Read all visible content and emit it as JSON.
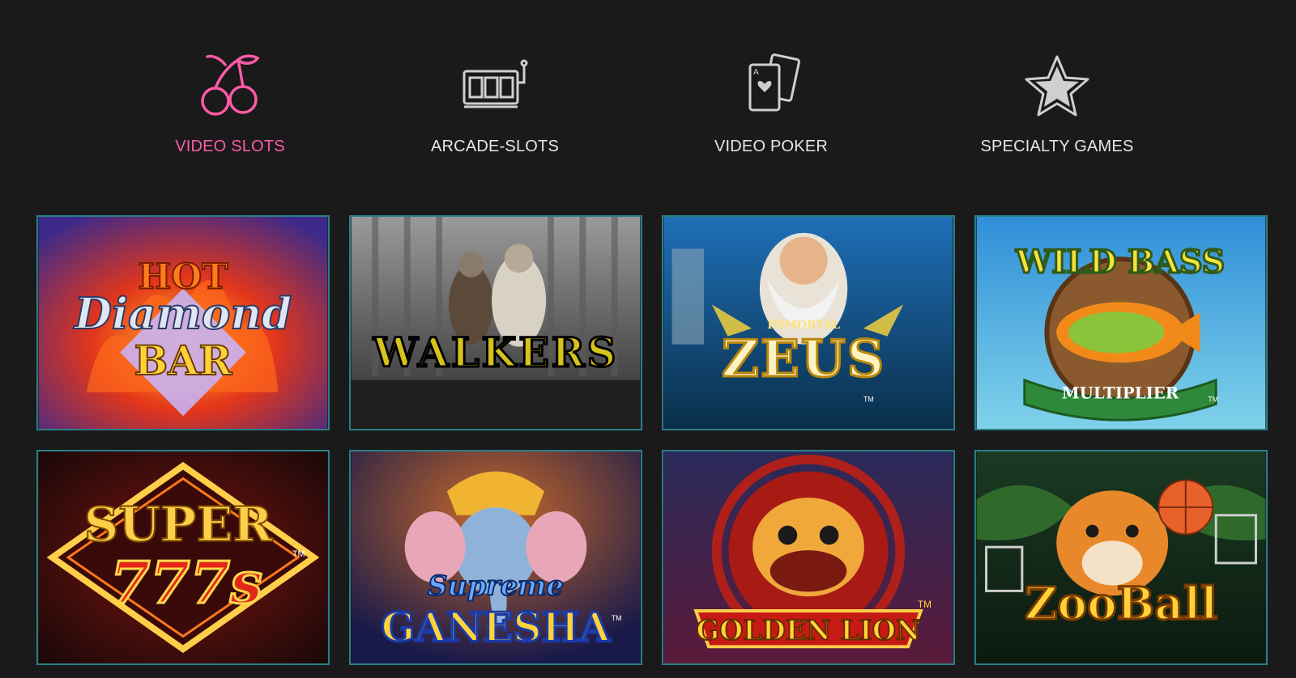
{
  "categories": [
    {
      "label": "VIDEO SLOTS",
      "icon": "cherry-icon",
      "active": true
    },
    {
      "label": "ARCADE-SLOTS",
      "icon": "slot-machine-icon",
      "active": false
    },
    {
      "label": "VIDEO POKER",
      "icon": "playing-cards-icon",
      "active": false
    },
    {
      "label": "SPECIALTY GAMES",
      "icon": "star-icon",
      "active": false
    }
  ],
  "colors": {
    "background": "#1a1a1b",
    "active": "#ff5aa6",
    "text": "#e6e6e6",
    "tile_border": "#2a7f86"
  },
  "games": [
    {
      "line1": "HOT",
      "line2": "Diamond",
      "line3": "BAR"
    },
    {
      "line1": "WALKERS"
    },
    {
      "line1": "IMMORTAL",
      "line2": "ZEUS",
      "tm": "TM"
    },
    {
      "line1": "WILD BASS",
      "line2": "MULTIPLIER",
      "tm": "TM"
    },
    {
      "line1": "SUPER",
      "line2": "777s",
      "tm": "TM"
    },
    {
      "line1": "Supreme",
      "line2": "GANESHA",
      "tm": "TM"
    },
    {
      "line1": "GOLDEN LION",
      "tm": "TM"
    },
    {
      "line1": "ZooBall"
    }
  ]
}
